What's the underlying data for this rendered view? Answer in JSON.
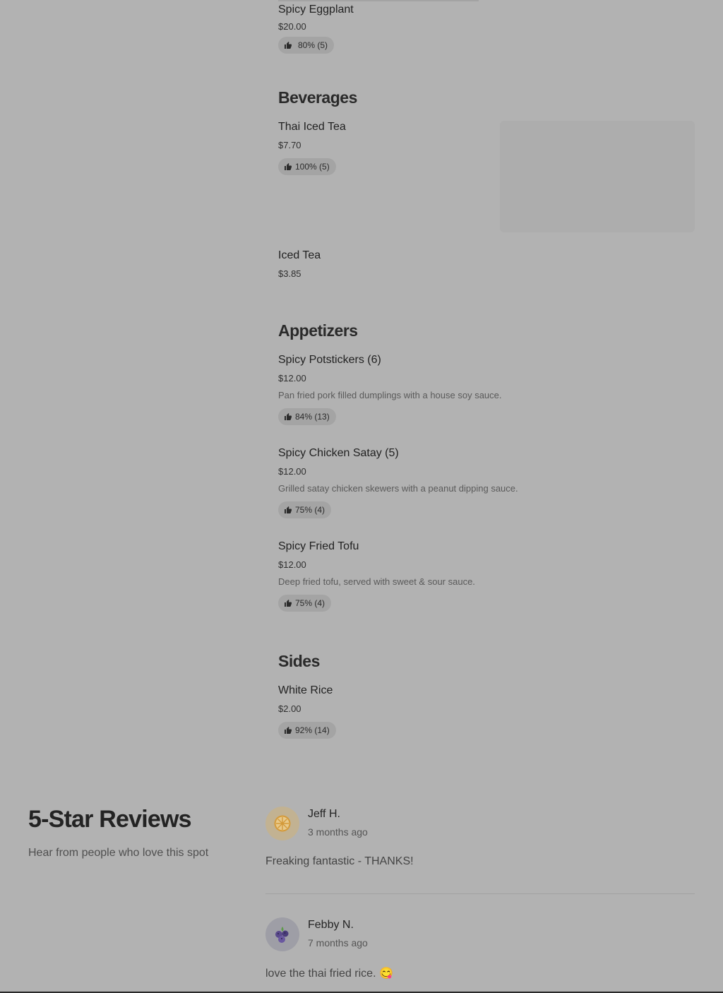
{
  "menu": {
    "eggplant": {
      "name": "Spicy Eggplant",
      "price": "$20.00",
      "rating": "80% (5)"
    },
    "beverages": {
      "title": "Beverages",
      "thai_tea": {
        "name": "Thai Iced Tea",
        "price": "$7.70",
        "rating": "100% (5)"
      },
      "iced_tea": {
        "name": "Iced Tea",
        "price": "$3.85"
      }
    },
    "appetizers": {
      "title": "Appetizers",
      "potstickers": {
        "name": "Spicy Potstickers (6)",
        "price": "$12.00",
        "desc": "Pan fried pork filled dumplings with a house soy sauce.",
        "rating": "84% (13)"
      },
      "satay": {
        "name": "Spicy Chicken Satay (5)",
        "price": "$12.00",
        "desc": "Grilled satay chicken skewers with a peanut dipping sauce.",
        "rating": "75% (4)"
      },
      "tofu": {
        "name": "Spicy Fried Tofu",
        "price": "$12.00",
        "desc": "Deep fried tofu, served with sweet & sour sauce.",
        "rating": "75% (4)"
      }
    },
    "sides": {
      "title": "Sides",
      "rice": {
        "name": "White Rice",
        "price": "$2.00",
        "rating": "92% (14)"
      }
    }
  },
  "reviews": {
    "title": "5-Star Reviews",
    "subtitle": "Hear from people who love this spot",
    "items": [
      {
        "name": "Jeff H.",
        "time": "3 months ago",
        "text": "Freaking fantastic - THANKS!",
        "avatar_icon": "citrus-slice-icon",
        "avatar_bg": "#c2b292"
      },
      {
        "name": "Febby N.",
        "time": "7 months ago",
        "text": "love the thai fried rice. 😋",
        "avatar_icon": "blueberry-icon",
        "avatar_bg": "#9e9ea6"
      }
    ]
  },
  "icons": {
    "rating": "thumbs-up-icon"
  }
}
